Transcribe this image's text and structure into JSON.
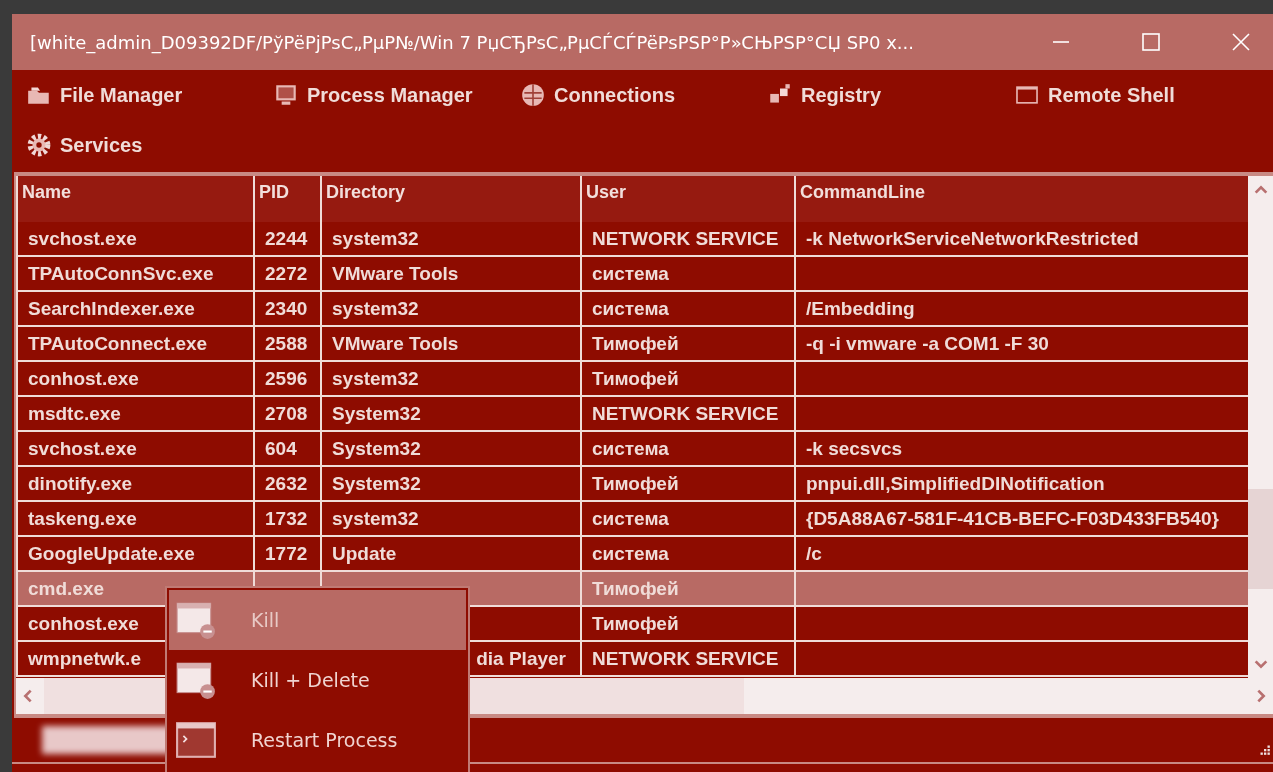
{
  "window": {
    "title": "[white_admin_D09392DF/PўPëPjPsC„PµP№/Win 7 PџCЂPsC„PµCЃCЃPëPsPSP°P»CЊPSP°CЏ SP0 x..."
  },
  "toolbar": [
    {
      "label": "File Manager"
    },
    {
      "label": "Process Manager"
    },
    {
      "label": "Connections"
    },
    {
      "label": "Registry"
    },
    {
      "label": "Remote Shell"
    },
    {
      "label": "Services"
    }
  ],
  "table": {
    "columns": [
      "Name",
      "PID",
      "Directory",
      "User",
      "CommandLine"
    ],
    "rows": [
      {
        "name": "svchost.exe",
        "pid": "2244",
        "directory": "system32",
        "user": "NETWORK SERVICE",
        "commandline": "-k NetworkServiceNetworkRestricted",
        "selected": false
      },
      {
        "name": "TPAutoConnSvc.exe",
        "pid": "2272",
        "directory": "VMware Tools",
        "user": "система",
        "selected": false
      },
      {
        "name": "SearchIndexer.exe",
        "pid": "2340",
        "directory": "system32",
        "user": "система",
        "commandline": "/Embedding",
        "selected": false
      },
      {
        "name": "TPAutoConnect.exe",
        "pid": "2588",
        "directory": "VMware Tools",
        "user": "Тимофей",
        "commandline": "-q -i vmware -a COM1 -F 30",
        "selected": false
      },
      {
        "name": "conhost.exe",
        "pid": "2596",
        "directory": "system32",
        "user": "Тимофей",
        "selected": false
      },
      {
        "name": "msdtc.exe",
        "pid": "2708",
        "directory": "System32",
        "user": "NETWORK SERVICE",
        "selected": false
      },
      {
        "name": "svchost.exe",
        "pid": "604",
        "directory": "System32",
        "user": "система",
        "commandline": "-k secsvcs",
        "selected": false
      },
      {
        "name": "dinotify.exe",
        "pid": "2632",
        "directory": "System32",
        "user": "Тимофей",
        "commandline": "pnpui.dll,SimplifiedDINotification",
        "selected": false
      },
      {
        "name": "taskeng.exe",
        "pid": "1732",
        "directory": "system32",
        "user": "система",
        "commandline": "{D5A88A67-581F-41CB-BEFC-F03D433FB540}",
        "selected": false
      },
      {
        "name": "GoogleUpdate.exe",
        "pid": "1772",
        "directory": "Update",
        "user": "система",
        "commandline": "/c",
        "selected": false
      },
      {
        "name": "cmd.exe",
        "user": "Тимофей",
        "selected": true
      },
      {
        "name": "conhost.exe",
        "user": "Тимофей",
        "selected": false
      },
      {
        "name": "wmpnetwk.e",
        "directory": "dia Player",
        "user": "NETWORK SERVICE",
        "selected": false
      }
    ]
  },
  "context_menu": [
    {
      "label": "Kill",
      "selected": true
    },
    {
      "label": "Kill + Delete",
      "selected": false
    },
    {
      "label": "Restart Process",
      "selected": false
    }
  ]
}
